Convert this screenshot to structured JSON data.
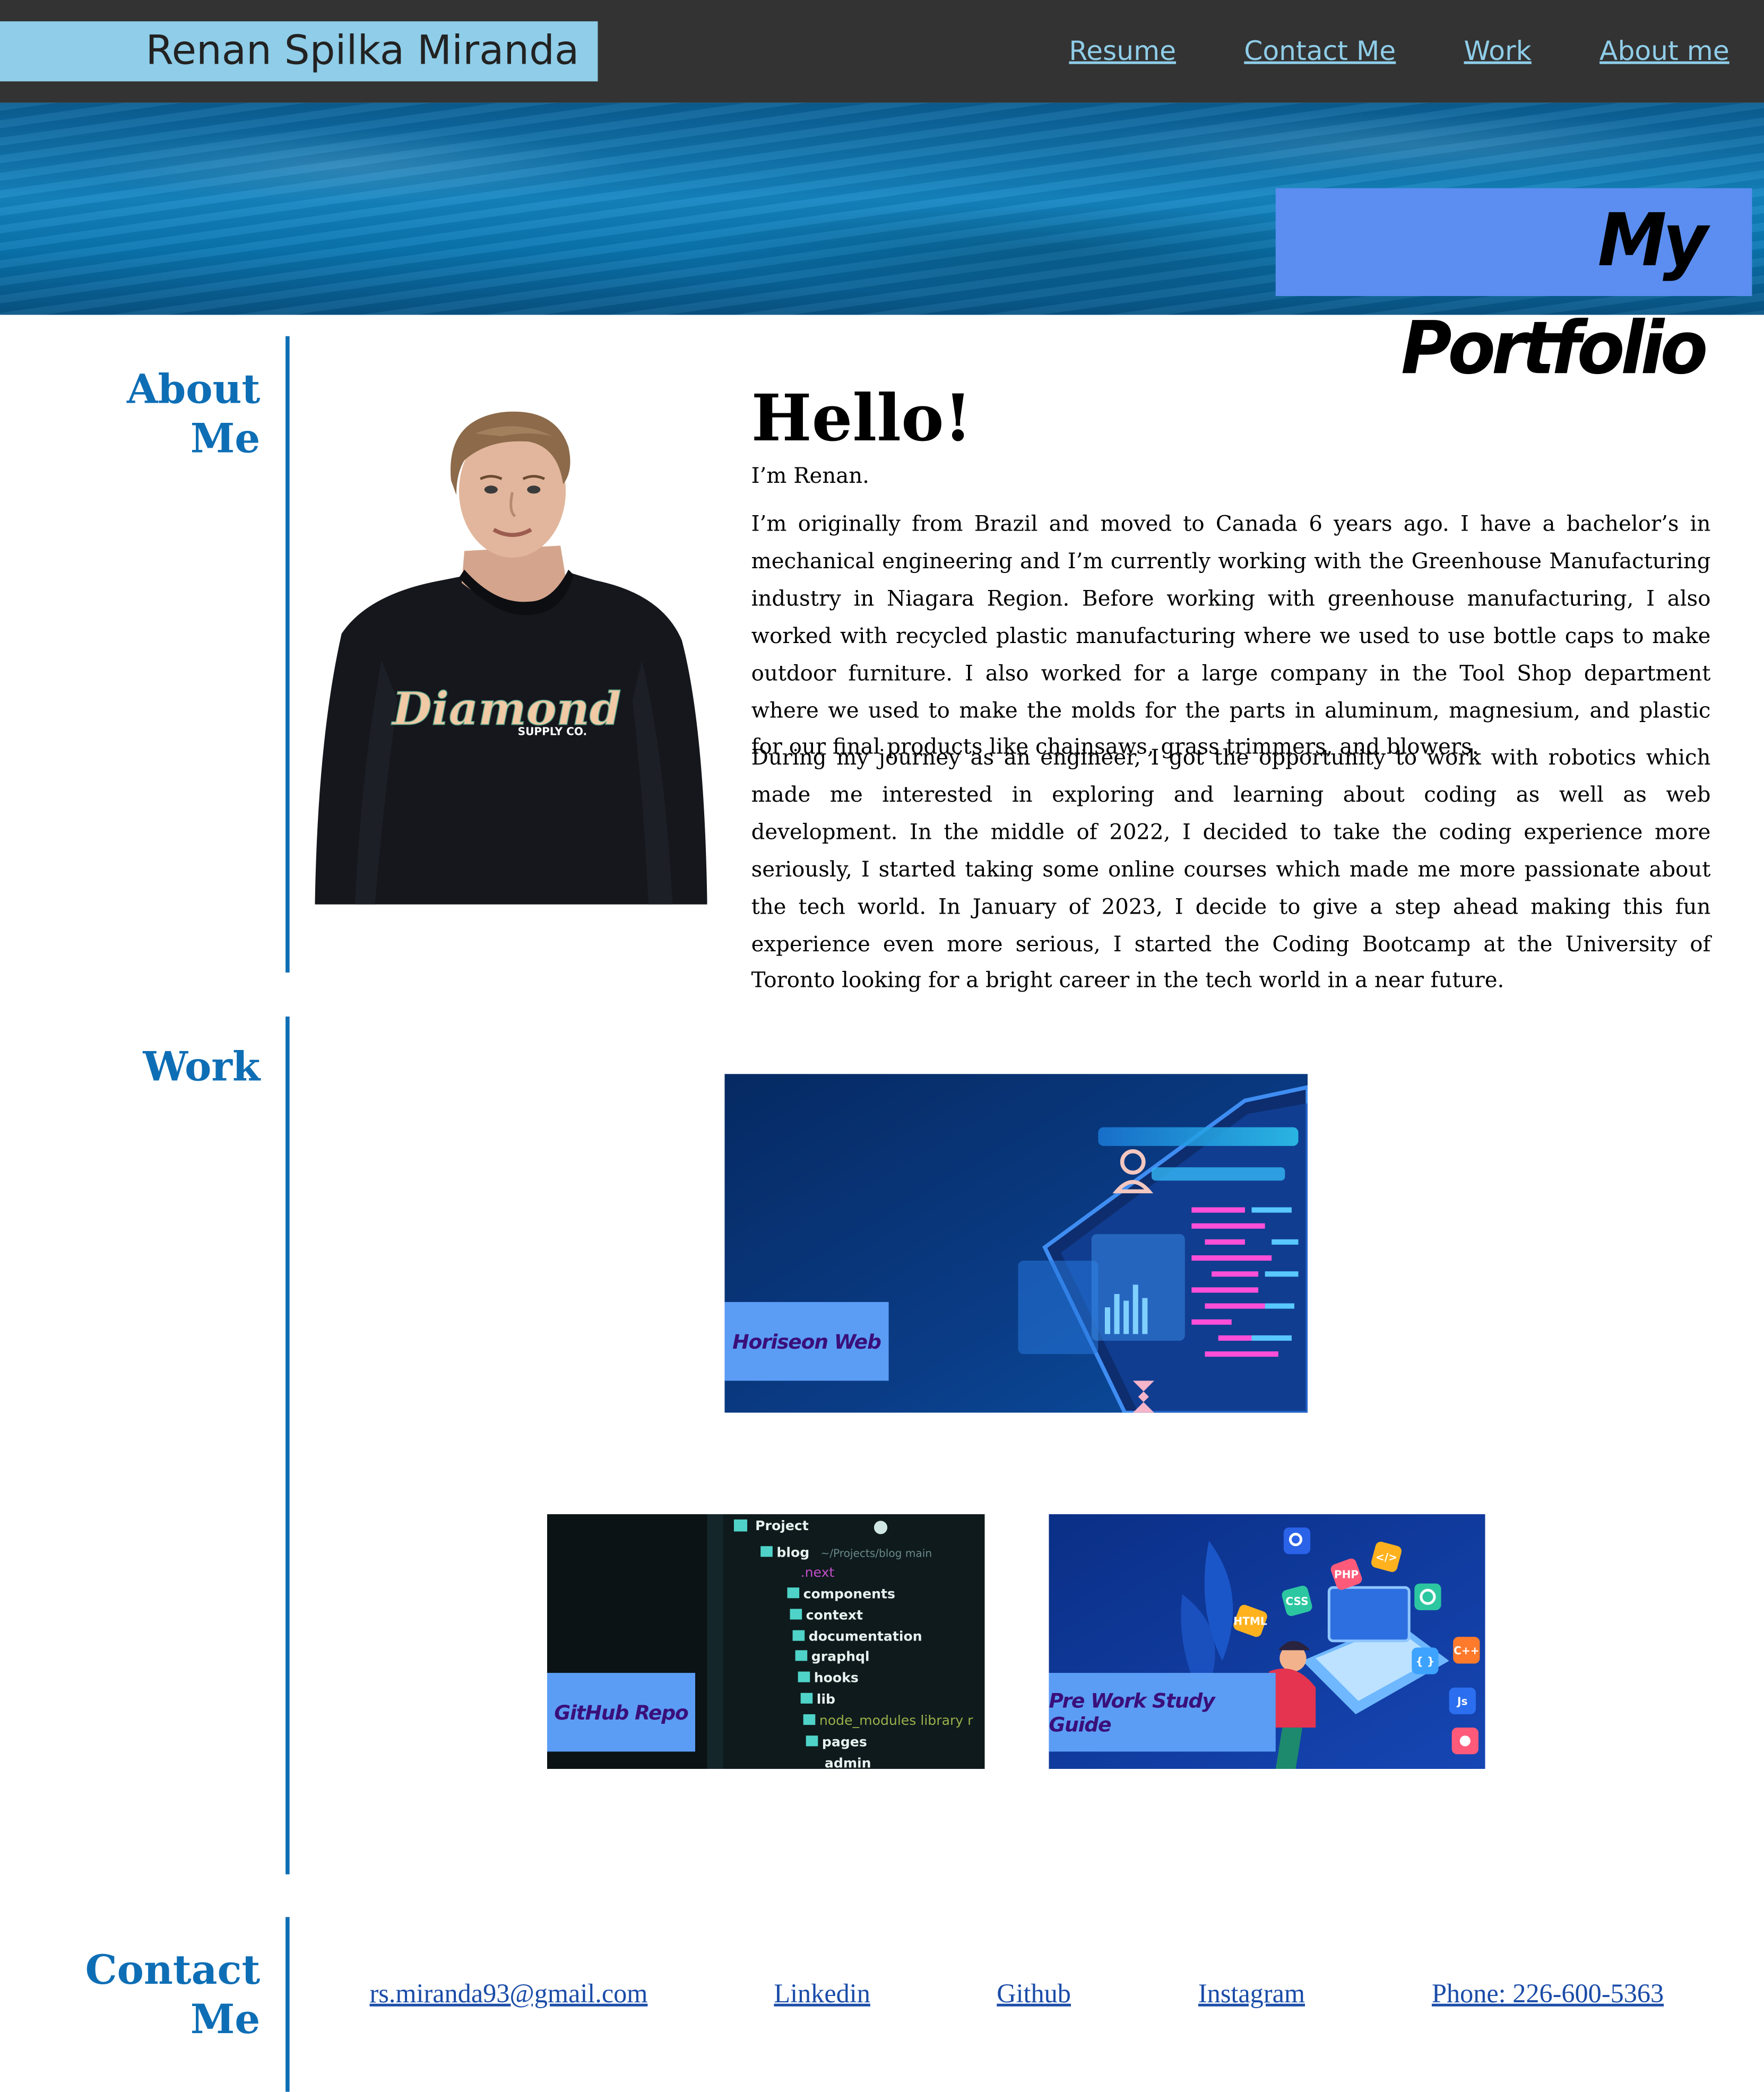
{
  "header": {
    "brand": "Renan Spilka Miranda",
    "nav": [
      {
        "label": "Resume"
      },
      {
        "label": "Contact Me"
      },
      {
        "label": "Work"
      },
      {
        "label": "About me"
      }
    ]
  },
  "hero": {
    "title": "My Portfolio"
  },
  "about": {
    "label_line1": "About",
    "label_line2": "Me",
    "heading": "Hello!",
    "intro": "I’m Renan.",
    "paragraph1": "I’m originally from Brazil and moved to Canada 6 years ago. I have a bachelor’s in mechanical engineering and I’m currently working with the Greenhouse Manufacturing industry in Niagara Region. Before working with greenhouse manufacturing, I also worked with recycled plastic manufacturing where we used to use bottle caps to make outdoor furniture. I also worked for a large company in the Tool Shop department where we used to make the molds for the parts in aluminum, magnesium, and plastic for our final products like chainsaws, grass trimmers, and blowers.",
    "paragraph2": "During my journey as an engineer, I got the opportunity to work with robotics which made me interested in exploring and learning about coding as well as web development. In the middle of 2022, I decided to take the coding experience more seriously, I started taking some online courses which made me more passionate about the tech world. In January of 2023, I decide to give a step ahead making this fun experience even more serious, I started the Coding Bootcamp at the University of Toronto looking for a bright career in the tech world in a near future.",
    "shirt_text": "Diamond",
    "shirt_subtext": "SUPPLY CO."
  },
  "work": {
    "label": "Work",
    "projects": [
      {
        "title": "Horiseon Web"
      },
      {
        "title": "GitHub Repo"
      },
      {
        "title": "Pre Work Study Guide"
      }
    ],
    "code_tree": [
      "Project",
      "blog",
      "~/Projects/blog main",
      ".next",
      "components",
      "context",
      "documentation",
      "graphql",
      "hooks",
      "lib",
      "node_modules library r",
      "pages",
      "admin"
    ],
    "tech_badges": [
      "PHP",
      "</>",
      "CSS",
      "HTML",
      "{ }",
      "C++",
      "Js"
    ]
  },
  "contact": {
    "label_line1": "Contact",
    "label_line2": "Me",
    "links": [
      {
        "label": "rs.miranda93@gmail.com"
      },
      {
        "label": "Linkedin"
      },
      {
        "label": "Github"
      },
      {
        "label": "Instagram"
      },
      {
        "label": "Phone: 226-600-5363"
      }
    ]
  }
}
